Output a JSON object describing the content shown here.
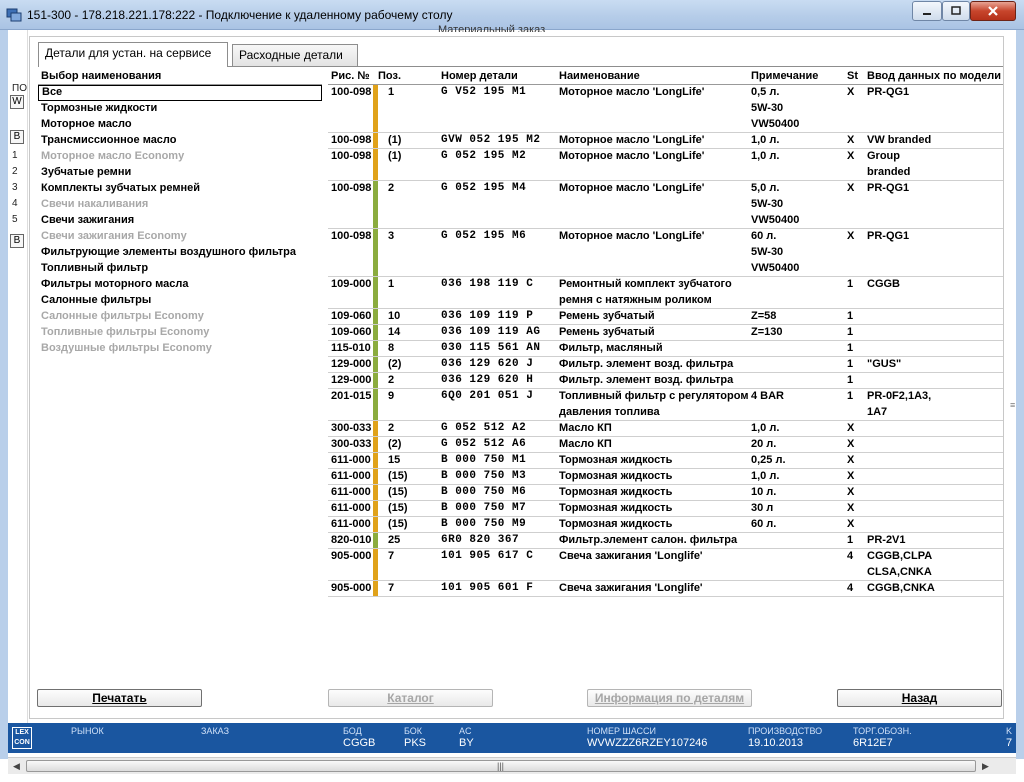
{
  "window": {
    "title": "151-300 - 178.218.221.178:222 - Подключение к удаленному рабочему столу"
  },
  "background": {
    "heading": "Материальный заказ",
    "left_labels": [
      "ПО",
      "W",
      "B",
      "1",
      "2",
      "3",
      "4",
      "5",
      "B"
    ]
  },
  "tabs": [
    {
      "label": "Детали для устан. на сервисе",
      "active": true
    },
    {
      "label": "Расходные детали",
      "active": false
    }
  ],
  "category_panel": {
    "header": "Выбор наименования",
    "items": [
      {
        "label": "Все",
        "state": "selected"
      },
      {
        "label": "Тормозные жидкости",
        "state": "normal"
      },
      {
        "label": "Моторное масло",
        "state": "normal"
      },
      {
        "label": "Трансмиссионное масло",
        "state": "normal"
      },
      {
        "label": "Моторное масло Economy",
        "state": "disabled"
      },
      {
        "label": "Зубчатые ремни",
        "state": "normal"
      },
      {
        "label": "Комплекты зубчатых ремней",
        "state": "normal"
      },
      {
        "label": "Свечи накаливания",
        "state": "disabled"
      },
      {
        "label": "Свечи зажигания",
        "state": "normal"
      },
      {
        "label": "Свечи зажигания Economy",
        "state": "disabled"
      },
      {
        "label": "Фильтрующие элементы воздушного фильтра",
        "state": "normal"
      },
      {
        "label": "Топливный фильтр",
        "state": "normal"
      },
      {
        "label": "Фильтры моторного масла",
        "state": "normal"
      },
      {
        "label": "Салонные фильтры",
        "state": "normal"
      },
      {
        "label": "Салонные фильтры Economy",
        "state": "disabled"
      },
      {
        "label": "Топливные фильтры Economy",
        "state": "disabled"
      },
      {
        "label": "Воздушные фильтры Economy",
        "state": "disabled"
      }
    ]
  },
  "table": {
    "headers": {
      "fig": "Рис. №",
      "pos": "Поз.",
      "part": "Номер детали",
      "name": "Наименование",
      "note": "Примечание",
      "st": "St",
      "model": "Ввод данных по модели"
    },
    "colors": {
      "orange": "#e0a21a",
      "green": "#8bac3e"
    },
    "rows": [
      {
        "fig": "100-098",
        "pos": "1",
        "part": "G   V52 195 M1",
        "name": [
          "Моторное масло 'LongLife'"
        ],
        "note": [
          "0,5 л.",
          "5W-30",
          "VW50400"
        ],
        "st": "X",
        "model": [
          "PR-QG1"
        ],
        "bar": "orange"
      },
      {
        "fig": "100-098",
        "pos": "(1)",
        "part": "GVW 052 195 M2",
        "name": [
          "Моторное масло 'LongLife'"
        ],
        "note": [
          "1,0 л."
        ],
        "st": "X",
        "model": [
          "VW branded"
        ],
        "bar": "orange"
      },
      {
        "fig": "100-098",
        "pos": "(1)",
        "part": "G   052 195 M2",
        "name": [
          "Моторное масло 'LongLife'"
        ],
        "note": [
          "1,0 л."
        ],
        "st": "X",
        "model": [
          "Group",
          "branded"
        ],
        "bar": "orange"
      },
      {
        "fig": "100-098",
        "pos": "2",
        "part": "G   052 195 M4",
        "name": [
          "Моторное масло 'LongLife'"
        ],
        "note": [
          "5,0 л.",
          "5W-30",
          "VW50400"
        ],
        "st": "X",
        "model": [
          "PR-QG1"
        ],
        "bar": "green"
      },
      {
        "fig": "100-098",
        "pos": "3",
        "part": "G   052 195 M6",
        "name": [
          "Моторное масло 'LongLife'"
        ],
        "note": [
          "60 л.",
          "5W-30",
          "VW50400"
        ],
        "st": "X",
        "model": [
          "PR-QG1"
        ],
        "bar": "green"
      },
      {
        "fig": "109-000",
        "pos": "1",
        "part": "036 198 119 C",
        "name": [
          "Ремонтный комплект зубчатого",
          "ремня с натяжным роликом"
        ],
        "note": [
          ""
        ],
        "st": "1",
        "model": [
          "CGGB"
        ],
        "bar": "green"
      },
      {
        "fig": "109-060",
        "pos": "10",
        "part": "036 109 119 P",
        "name": [
          "Ремень зубчатый"
        ],
        "note": [
          "Z=58"
        ],
        "st": "1",
        "model": [
          ""
        ],
        "bar": "green"
      },
      {
        "fig": "109-060",
        "pos": "14",
        "part": "036 109 119 AG",
        "name": [
          "Ремень зубчатый"
        ],
        "note": [
          "Z=130"
        ],
        "st": "1",
        "model": [
          ""
        ],
        "bar": "green"
      },
      {
        "fig": "115-010",
        "pos": "8",
        "part": "030 115 561 AN",
        "name": [
          "Фильтр, масляный"
        ],
        "note": [
          ""
        ],
        "st": "1",
        "model": [
          ""
        ],
        "bar": "green"
      },
      {
        "fig": "129-000",
        "pos": "(2)",
        "part": "036 129 620 J",
        "name": [
          "Фильтр. элемент возд. фильтра"
        ],
        "note": [
          ""
        ],
        "st": "1",
        "model": [
          "\"GUS\""
        ],
        "bar": "green"
      },
      {
        "fig": "129-000",
        "pos": "2",
        "part": "036 129 620 H",
        "name": [
          "Фильтр. элемент возд. фильтра"
        ],
        "note": [
          ""
        ],
        "st": "1",
        "model": [
          ""
        ],
        "bar": "green"
      },
      {
        "fig": "201-015",
        "pos": "9",
        "part": "6Q0 201 051 J",
        "name": [
          "Топливный фильтр с регулятором",
          "давления топлива"
        ],
        "note": [
          "4 BAR"
        ],
        "st": "1",
        "model": [
          "PR-0F2,1A3,",
          "1A7"
        ],
        "bar": "green"
      },
      {
        "fig": "300-033",
        "pos": "2",
        "part": "G   052 512 A2",
        "name": [
          "Масло КП"
        ],
        "note": [
          "1,0 л."
        ],
        "st": "X",
        "model": [
          ""
        ],
        "bar": "orange"
      },
      {
        "fig": "300-033",
        "pos": "(2)",
        "part": "G   052 512 A6",
        "name": [
          "Масло КП"
        ],
        "note": [
          "20 л."
        ],
        "st": "X",
        "model": [
          ""
        ],
        "bar": "orange"
      },
      {
        "fig": "611-000",
        "pos": "15",
        "part": "B   000 750 M1",
        "name": [
          "Тормозная жидкость"
        ],
        "note": [
          "0,25 л."
        ],
        "st": "X",
        "model": [
          ""
        ],
        "bar": "orange"
      },
      {
        "fig": "611-000",
        "pos": "(15)",
        "part": "B   000 750 M3",
        "name": [
          "Тормозная жидкость"
        ],
        "note": [
          "1,0 л."
        ],
        "st": "X",
        "model": [
          ""
        ],
        "bar": "orange"
      },
      {
        "fig": "611-000",
        "pos": "(15)",
        "part": "B   000 750 M6",
        "name": [
          "Тормозная жидкость"
        ],
        "note": [
          "10 л."
        ],
        "st": "X",
        "model": [
          ""
        ],
        "bar": "orange"
      },
      {
        "fig": "611-000",
        "pos": "(15)",
        "part": "B   000 750 M7",
        "name": [
          "Тормозная жидкость"
        ],
        "note": [
          "30 л"
        ],
        "st": "X",
        "model": [
          ""
        ],
        "bar": "orange"
      },
      {
        "fig": "611-000",
        "pos": "(15)",
        "part": "B   000 750 M9",
        "name": [
          "Тормозная жидкость"
        ],
        "note": [
          "60 л."
        ],
        "st": "X",
        "model": [
          ""
        ],
        "bar": "orange"
      },
      {
        "fig": "820-010",
        "pos": "25",
        "part": "6R0 820 367",
        "name": [
          "Фильтр.элемент салон. фильтра"
        ],
        "note": [
          ""
        ],
        "st": "1",
        "model": [
          "PR-2V1"
        ],
        "bar": "green"
      },
      {
        "fig": "905-000",
        "pos": "7",
        "part": "101 905 617 C",
        "name": [
          "Свеча зажигания 'Longlife'"
        ],
        "note": [
          ""
        ],
        "st": "4",
        "model": [
          "CGGB,CLPA",
          "CLSA,CNKA"
        ],
        "bar": "orange"
      },
      {
        "fig": "905-000",
        "pos": "7",
        "part": "101 905 601 F",
        "name": [
          "Свеча зажигания 'Longlife'"
        ],
        "note": [
          ""
        ],
        "st": "4",
        "model": [
          "CGGB,CNKA"
        ],
        "bar": "orange"
      }
    ]
  },
  "buttons": {
    "print": "Печатать",
    "catalog": "Каталог",
    "info": "Информация по деталям",
    "back": "Назад"
  },
  "statusbar": {
    "logo": "LEX CON",
    "fields": [
      {
        "label": "РЫНОК",
        "value": ""
      },
      {
        "label": "ЗАКАЗ",
        "value": ""
      },
      {
        "label": "БОД",
        "value": "CGGB"
      },
      {
        "label": "БОК",
        "value": "PKS"
      },
      {
        "label": "AC",
        "value": "BY"
      },
      {
        "label": "НОМЕР ШАССИ",
        "value": "WVWZZZ6RZEY107246"
      },
      {
        "label": "ПРОИЗВОДСТВО",
        "value": "19.10.2013"
      },
      {
        "label": "ТОРГ.ОБОЗН.",
        "value": "6R12E7"
      },
      {
        "label": "K",
        "value": "7"
      }
    ]
  }
}
